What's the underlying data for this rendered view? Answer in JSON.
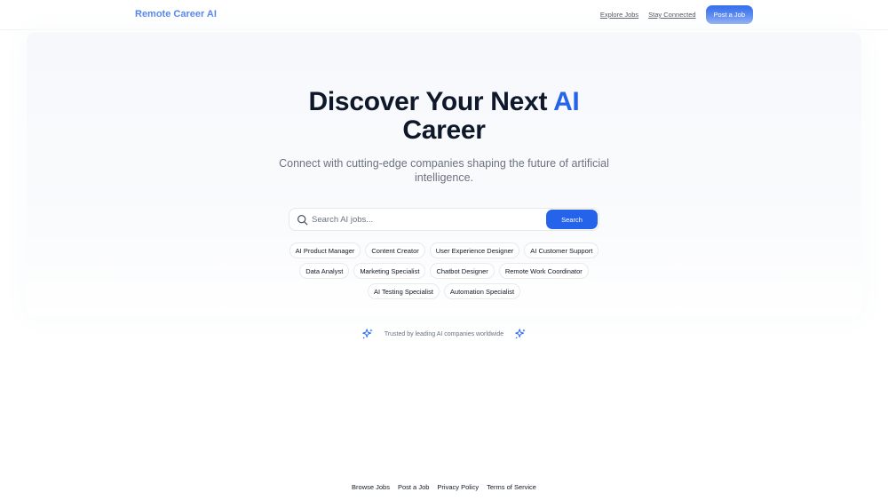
{
  "header": {
    "brand": "Remote Career AI",
    "nav": {
      "explore_jobs": "Explore Jobs",
      "stay_connected": "Stay Connected",
      "post_job": "Post a Job"
    }
  },
  "hero": {
    "title_prefix": "Discover Your Next",
    "title_accent": "AI",
    "title_suffix": "Career",
    "subtitle": "Connect with cutting-edge companies shaping the future of artificial intelligence.",
    "search": {
      "placeholder": "Search AI jobs...",
      "button": "Search"
    },
    "tags": [
      "AI Product Manager",
      "Content Creator",
      "User Experience Designer",
      "AI Customer Support",
      "Data Analyst",
      "Marketing Specialist",
      "Chatbot Designer",
      "Remote Work Coordinator",
      "AI Testing Specialist",
      "Automation Specialist"
    ],
    "trusted": "Trusted by leading AI companies worldwide"
  },
  "footer": {
    "links": [
      "Browse Jobs",
      "Post a Job",
      "Privacy Policy",
      "Terms of Service"
    ]
  },
  "colors": {
    "accent": "#2563eb",
    "text": "#0f172a",
    "muted": "#6b7280"
  }
}
